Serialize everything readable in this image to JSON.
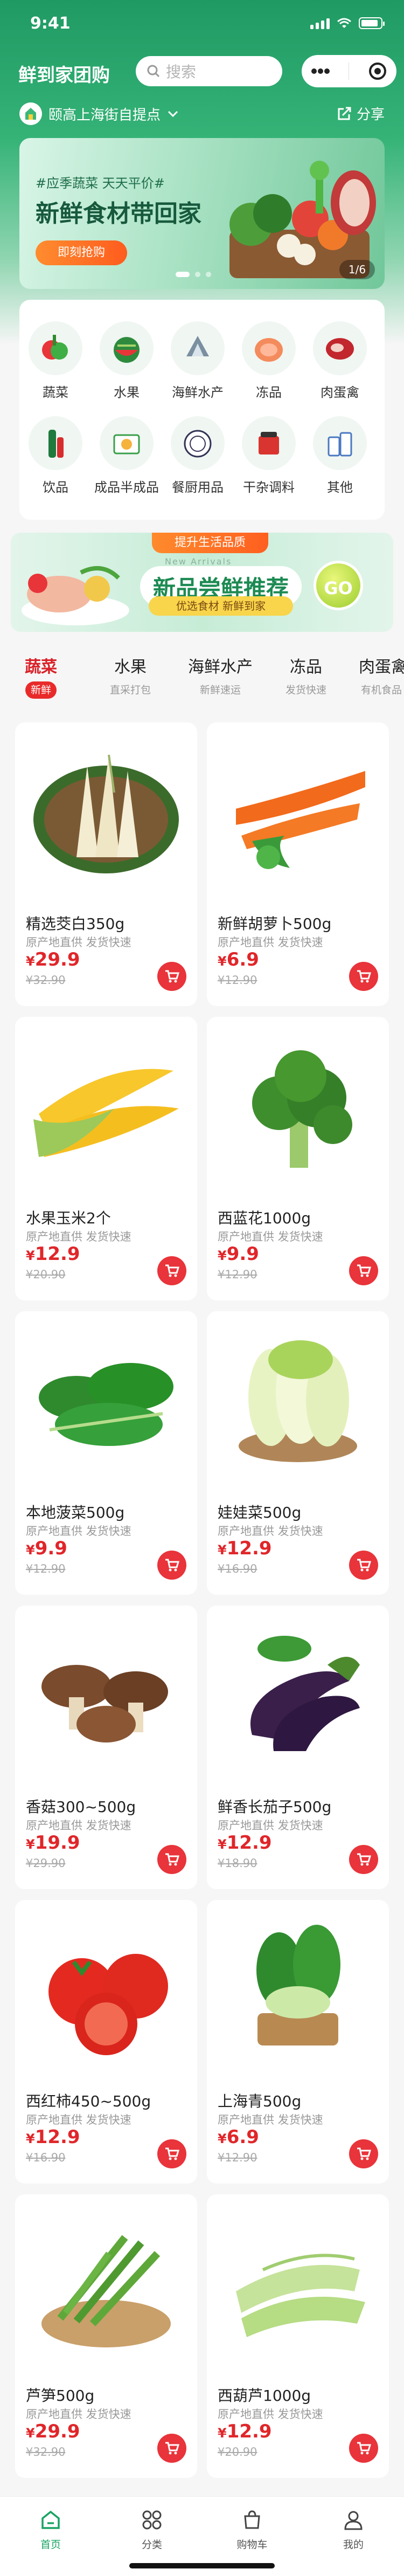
{
  "status": {
    "time": "9:41"
  },
  "header": {
    "title": "鲜到家团购",
    "search_placeholder": "搜索"
  },
  "location": {
    "store": "颐高上海街自提点",
    "share": "分享"
  },
  "banner": {
    "tag": "#应季蔬菜 天天平价#",
    "headline": "新鲜食材带回家",
    "button": "即刻抢购",
    "counter": "1/6"
  },
  "categories": [
    {
      "label": "蔬菜",
      "icon": "vegetables-icon"
    },
    {
      "label": "水果",
      "icon": "fruit-icon"
    },
    {
      "label": "海鲜水产",
      "icon": "seafood-icon"
    },
    {
      "label": "冻品",
      "icon": "frozen-food-icon"
    },
    {
      "label": "肉蛋禽",
      "icon": "meat-icon"
    },
    {
      "label": "饮品",
      "icon": "drinks-icon"
    },
    {
      "label": "成品半成品",
      "icon": "prepared-food-icon"
    },
    {
      "label": "餐厨用品",
      "icon": "kitchenware-icon"
    },
    {
      "label": "干杂调料",
      "icon": "seasoning-icon"
    },
    {
      "label": "其他",
      "icon": "other-icon"
    }
  ],
  "promo": {
    "ribbon": "提升生活品质",
    "english": "New Arrivals",
    "title": "新品尝鲜推荐",
    "subtitle": "优选食材 新鲜到家",
    "go": "GO"
  },
  "tabs": [
    {
      "title": "蔬菜",
      "sub": "新鲜"
    },
    {
      "title": "水果",
      "sub": "直采打包"
    },
    {
      "title": "海鲜水产",
      "sub": "新鲜速运"
    },
    {
      "title": "冻品",
      "sub": "发货快速"
    },
    {
      "title": "肉蛋禽",
      "sub": "有机食品"
    }
  ],
  "products": [
    {
      "name": "精选茭白350g",
      "desc": "原产地直供 发货快速",
      "price": "29.9",
      "old": "¥32.90",
      "icon": "water-bamboo-icon"
    },
    {
      "name": "新鲜胡萝卜500g",
      "desc": "原产地直供 发货快速",
      "price": "6.9",
      "old": "¥12.90",
      "icon": "carrot-icon"
    },
    {
      "name": "水果玉米2个",
      "desc": "原产地直供 发货快速",
      "price": "12.9",
      "old": "¥20.90",
      "icon": "corn-icon"
    },
    {
      "name": "西蓝花1000g",
      "desc": "原产地直供 发货快速",
      "price": "9.9",
      "old": "¥12.90",
      "icon": "broccoli-icon"
    },
    {
      "name": "本地菠菜500g",
      "desc": "原产地直供 发货快速",
      "price": "9.9",
      "old": "¥12.90",
      "icon": "spinach-icon"
    },
    {
      "name": "娃娃菜500g",
      "desc": "原产地直供 发货快速",
      "price": "12.9",
      "old": "¥16.90",
      "icon": "baby-cabbage-icon"
    },
    {
      "name": "香菇300~500g",
      "desc": "原产地直供 发货快速",
      "price": "19.9",
      "old": "¥29.90",
      "icon": "mushroom-icon"
    },
    {
      "name": "鲜香长茄子500g",
      "desc": "原产地直供 发货快速",
      "price": "12.9",
      "old": "¥18.90",
      "icon": "eggplant-icon"
    },
    {
      "name": "西红柿450~500g",
      "desc": "原产地直供 发货快速",
      "price": "12.9",
      "old": "¥16.90",
      "icon": "tomato-icon"
    },
    {
      "name": "上海青500g",
      "desc": "原产地直供 发货快速",
      "price": "6.9",
      "old": "¥12.90",
      "icon": "bok-choy-icon"
    },
    {
      "name": "芦笋500g",
      "desc": "原产地直供 发货快速",
      "price": "29.9",
      "old": "¥32.90",
      "icon": "asparagus-icon"
    },
    {
      "name": "西葫芦1000g",
      "desc": "原产地直供 发货快速",
      "price": "12.9",
      "old": "¥20.90",
      "icon": "zucchini-icon"
    }
  ],
  "currency": "¥",
  "tabbar": [
    {
      "label": "首页",
      "icon": "home-icon"
    },
    {
      "label": "分类",
      "icon": "category-icon"
    },
    {
      "label": "购物车",
      "icon": "cart-icon"
    },
    {
      "label": "我的",
      "icon": "user-icon"
    }
  ],
  "colors": {
    "brand": "#1f9a63",
    "price": "#e0262a",
    "active_tab": "#19a463"
  }
}
